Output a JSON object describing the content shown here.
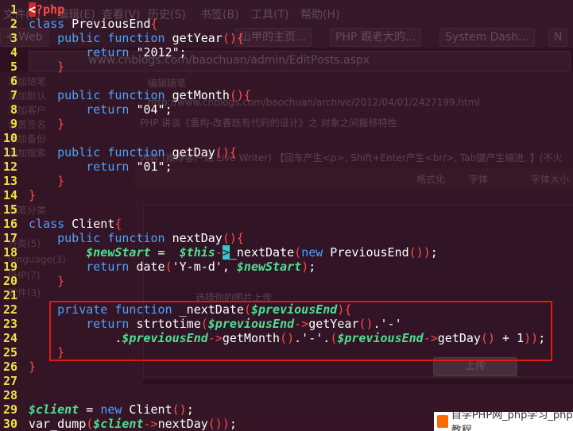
{
  "background": {
    "menu": [
      "文件(F)",
      "编辑(E)",
      "查看(V)",
      "历史(S)",
      "书签(B)",
      "工具(T)",
      "帮助(H)"
    ],
    "tabs": [
      "+ Web",
      "山甲的主页...",
      "PHP 跟老大的...",
      "System Dash...",
      "N"
    ],
    "url": "www.cnblogs.com/baochuan/admin/EditPosts.aspx",
    "sidebar_items": [
      "添加随笔",
      "添加默认",
      "添加客户",
      "设置签名",
      "添加备份",
      "添加搜索",
      "随笔分类",
      "分类(5)",
      "language(3)",
      "PHP(7)",
      "软件(3)"
    ],
    "content": {
      "heading": "编辑随笔",
      "permalink": "http://www.cnblogs.com/baochuan/archive/2012/04/01/2427199.html",
      "post_title": "PHP 讲谈《重构-改善既有代码的设计》之 对象之间搬移特性",
      "hint": "内容 (推荐客户端 Live Writer) 【回车产生<p>, Shift+Enter产生<br/>, Tab键产生缩进, 】(不火",
      "format_label": "格式化",
      "font_label": "字体",
      "font_size_label": "字体大小",
      "upload_prompt": "选择你的图片上传",
      "upload_button": "上传"
    }
  },
  "code_lines": [
    {
      "n": "1",
      "html": "<span class=\"tag\"><span class=\"tagbox\">&lt;</span>?php</span>"
    },
    {
      "n": "2",
      "html": "<span class=\"kw\">class</span> PreviousEnd<span class=\"br\">{</span>"
    },
    {
      "n": "3",
      "html": "    <span class=\"kw\">public function</span> getYear<span class=\"br\">(){</span>"
    },
    {
      "n": "4",
      "html": "        <span class=\"kw\">return</span> \"2012\";"
    },
    {
      "n": "5",
      "html": "    <span class=\"br\">}</span>"
    },
    {
      "n": "6",
      "html": ""
    },
    {
      "n": "7",
      "html": "    <span class=\"kw\">public function</span> getMonth<span class=\"br\">(){</span>"
    },
    {
      "n": "8",
      "html": "        <span class=\"kw\">return</span> \"04\";"
    },
    {
      "n": "9",
      "html": "    <span class=\"br\">}</span>"
    },
    {
      "n": "10",
      "html": ""
    },
    {
      "n": "11",
      "html": "    <span class=\"kw\">public function</span> getDay<span class=\"br\">(){</span>"
    },
    {
      "n": "12",
      "html": "        <span class=\"kw\">return</span> \"01\";"
    },
    {
      "n": "13",
      "html": "    <span class=\"br\">}</span>"
    },
    {
      "n": "14",
      "html": "<span class=\"br\">}</span>"
    },
    {
      "n": "15",
      "html": ""
    },
    {
      "n": "16",
      "html": "<span class=\"kw\">class</span> Client<span class=\"br\">{</span>"
    },
    {
      "n": "17",
      "html": "    <span class=\"kw\">public function</span> nextDay<span class=\"br\">(){</span>"
    },
    {
      "n": "18",
      "html": "        <span class=\"var\">$newStart</span> =  <span class=\"this\">$this</span><span class=\"op\">-<span class=\"cursor\">&gt;</span></span>_nextDate<span class=\"br\">(</span><span class=\"kw\">new</span> PreviousEnd<span class=\"br\">()</span><span class=\"br\">)</span>;"
    },
    {
      "n": "19",
      "html": "        <span class=\"kw\">return</span> date<span class=\"br\">(</span>'Y-m-d', <span class=\"var\">$newStart</span><span class=\"br\">)</span>;"
    },
    {
      "n": "20",
      "html": "    <span class=\"br\">}</span>"
    },
    {
      "n": "21",
      "html": ""
    },
    {
      "n": "22",
      "html": "    <span class=\"kw\">private function</span> _nextDate<span class=\"br\">(</span><span class=\"var\">$previousEnd</span><span class=\"br\">){</span>"
    },
    {
      "n": "23",
      "html": "        <span class=\"kw\">return</span> strtotime<span class=\"br\">(</span><span class=\"var\">$previousEnd</span><span class=\"op\">-&gt;</span>getYear<span class=\"br\">()</span>.'-'"
    },
    {
      "n": "24",
      "html": "            .<span class=\"var\">$previousEnd</span><span class=\"op\">-&gt;</span>getMonth<span class=\"br\">()</span>.'-'.<span class=\"br\">(</span><span class=\"var\">$previousEnd</span><span class=\"op\">-&gt;</span>getDay<span class=\"br\">()</span> + 1<span class=\"br\">))</span>;"
    },
    {
      "n": "25",
      "html": "    <span class=\"br\">}</span>"
    },
    {
      "n": "26",
      "html": "<span class=\"br\">}</span>"
    },
    {
      "n": "27",
      "html": ""
    },
    {
      "n": "28",
      "html": ""
    },
    {
      "n": "29",
      "html": "<span class=\"var\">$client</span> = <span class=\"kw\">new</span> Client<span class=\"br\">()</span>;"
    },
    {
      "n": "30",
      "html": "var_dump<span class=\"br\">(</span><span class=\"var\">$client</span><span class=\"op\">-&gt;</span>nextDay<span class=\"br\">())</span>;"
    }
  ],
  "watermark": "自学PHP网_php学习_php教程"
}
